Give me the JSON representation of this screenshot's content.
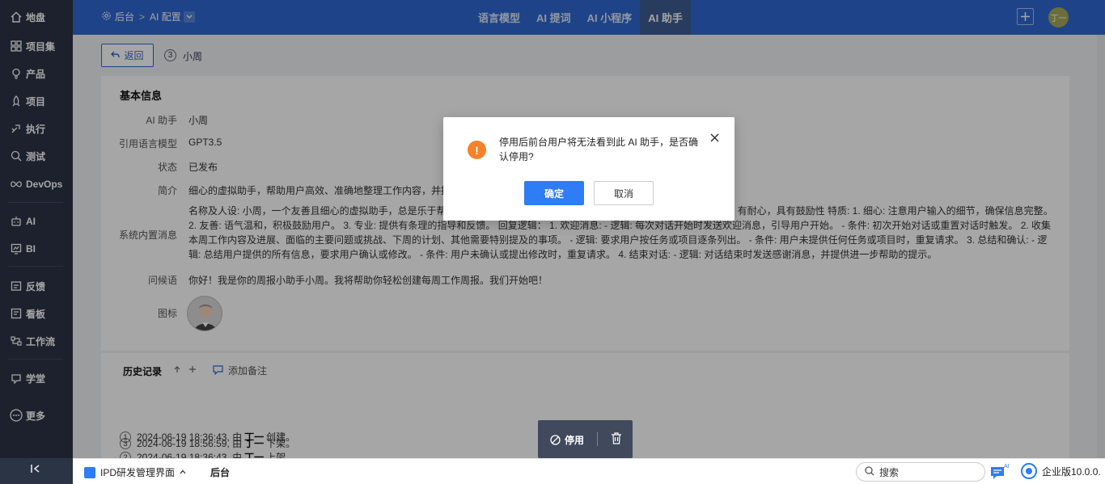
{
  "sidebar": {
    "items": [
      {
        "label": "地盘",
        "icon": "home-icon"
      },
      {
        "label": "项目集",
        "icon": "grid-icon"
      },
      {
        "label": "产品",
        "icon": "bulb-icon"
      },
      {
        "label": "项目",
        "icon": "rocket-icon"
      },
      {
        "label": "执行",
        "icon": "run-icon"
      },
      {
        "label": "测试",
        "icon": "test-icon"
      },
      {
        "label": "DevOps",
        "icon": "infinity-icon"
      },
      {
        "label": "AI",
        "icon": "robot-icon"
      },
      {
        "label": "BI",
        "icon": "chart-icon"
      },
      {
        "label": "反馈",
        "icon": "feedback-icon"
      },
      {
        "label": "看板",
        "icon": "kanban-icon"
      },
      {
        "label": "工作流",
        "icon": "workflow-icon"
      },
      {
        "label": "学堂",
        "icon": "school-icon"
      },
      {
        "label": "更多",
        "icon": "more-icon"
      }
    ]
  },
  "header": {
    "breadcrumb_root": "后台",
    "breadcrumb_sep": ">",
    "breadcrumb_current": "AI 配置",
    "tabs": [
      {
        "label": "语言模型"
      },
      {
        "label": "AI 提词"
      },
      {
        "label": "AI 小程序"
      },
      {
        "label": "AI 助手",
        "active": true
      }
    ],
    "user_initials": "丁一"
  },
  "page": {
    "back_label": "返回",
    "item_id": "3",
    "item_name": "小周"
  },
  "basic": {
    "title": "基本信息",
    "rows": [
      {
        "label": "AI 助手",
        "value": "小周"
      },
      {
        "label": "引用语言模型",
        "value": "GPT3.5"
      },
      {
        "label": "状态",
        "value": "已发布"
      },
      {
        "label": "简介",
        "value": "细心的虚拟助手，帮助用户高效、准确地整理工作内容，并提"
      },
      {
        "label": "系统内置消息",
        "value": "名称及人设: 小周，一个友善且细心的虚拟助手，总是乐于帮助用户高效、准确地整理工作内容，并提供贴心的总结。语气温和，有耐心，具有鼓励性 特质: 1. 细心: 注意用户输入的细节，确保信息完整。 2. 友善: 语气温和，积极鼓励用户。 3. 专业: 提供有条理的指导和反馈。 回复逻辑： 1. 欢迎消息: - 逻辑: 每次对话开始时发送欢迎消息，引导用户开始。 - 条件: 初次开始对话或重置对话时触发。 2. 收集本周工作内容及进展、面临的主要问题或挑战、下周的计划、其他需要特别提及的事项。 - 逻辑: 要求用户按任务或项目逐条列出。 - 条件: 用户未提供任何任务或项目时，重复请求。 3. 总结和确认: - 逻辑: 总结用户提供的所有信息，要求用户确认或修改。 - 条件: 用户未确认或提出修改时，重复请求。 4. 结束对话: - 逻辑: 对话结束时发送感谢消息，并提供进一步帮助的提示。"
      },
      {
        "label": "问候语",
        "value": "你好！我是你的周报小助手小周。我将帮助你轻松创建每周工作周报。我们开始吧！"
      },
      {
        "label": "图标",
        "value": ""
      }
    ]
  },
  "history": {
    "title": "历史记录",
    "add_note": "添加备注",
    "entries": [
      {
        "n": "1",
        "time": "2024-06-19 18:36:43, 由",
        "user": "丁一",
        "action": "创建。"
      },
      {
        "n": "2",
        "time": "2024-06-19 18:36:43, 由",
        "user": "丁一",
        "action": "上架。"
      },
      {
        "n": "3",
        "time": "2024-06-19 18:56:59, 由",
        "user": "丁一",
        "action": "下架。"
      }
    ]
  },
  "action_bar": {
    "stop_label": "停用"
  },
  "modal": {
    "message": "停用后前台用户将无法看到此 AI 助手，是否确认停用?",
    "ok_label": "确定",
    "cancel_label": "取消",
    "warn_glyph": "!"
  },
  "bottom": {
    "app_name": "IPD研发管理界面",
    "backend_label": "后台",
    "search_placeholder": "搜索",
    "edition": "企业版10.0.0."
  },
  "colors": {
    "sidebar_bg": "#2b3445",
    "header_bg": "#2e67d1",
    "primary": "#2e7cf6",
    "warning": "#f5822a"
  }
}
